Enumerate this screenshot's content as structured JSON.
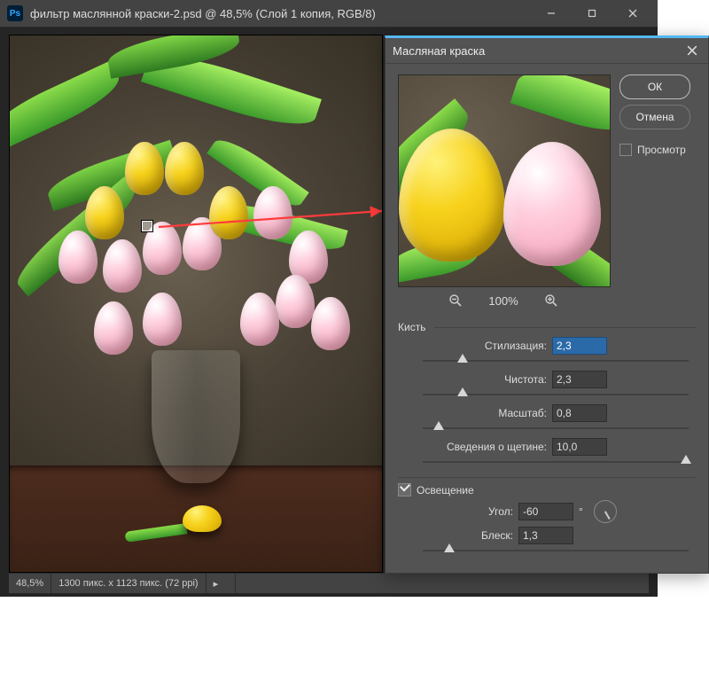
{
  "main_window": {
    "title": "фильтр маслянной краски-2.psd @ 48,5% (Слой 1 копия, RGB/8)",
    "zoom": "48,5%",
    "doc_info": "1300 пикс. x 1123 пикс. (72 ppi)"
  },
  "dialog": {
    "title": "Масляная краска",
    "buttons": {
      "ok": "ОК",
      "cancel": "Отмена"
    },
    "preview_checkbox": {
      "label": "Просмотр",
      "checked": false
    },
    "zoom": {
      "level": "100%"
    },
    "brush_section": {
      "title": "Кисть",
      "stylization": {
        "label": "Стилизация:",
        "value": "2,3",
        "thumb_pct": 15
      },
      "cleanliness": {
        "label": "Чистота:",
        "value": "2,3",
        "thumb_pct": 15
      },
      "scale": {
        "label": "Масштаб:",
        "value": "0,8",
        "thumb_pct": 6
      },
      "bristle_detail": {
        "label": "Сведения о щетине:",
        "value": "10,0",
        "thumb_pct": 99
      }
    },
    "lighting_section": {
      "title": "Освещение",
      "enabled": true,
      "angle": {
        "label": "Угол:",
        "value": "-60",
        "suffix": "°"
      },
      "shine": {
        "label": "Блеск:",
        "value": "1,3",
        "thumb_pct": 10
      }
    }
  }
}
